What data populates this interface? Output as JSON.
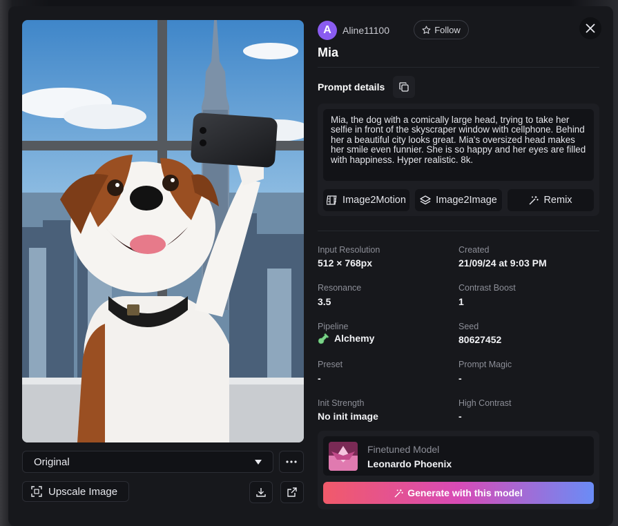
{
  "user": {
    "avatar_letter": "A",
    "name": "Aline11100",
    "follow_label": "Follow"
  },
  "title": "Mia",
  "prompt": {
    "label": "Prompt details",
    "text": "Mia, the dog with a comically large head, trying to take her selfie in front of the skyscraper window with cellphone. Behind her a beautiful city looks great. Mia's oversized head makes her smile even funnier. She is so happy and her eyes are filled with happiness. Hyper realistic. 8k.",
    "buttons": [
      "Image2Motion",
      "Image2Image",
      "Remix"
    ]
  },
  "details": {
    "input_resolution": {
      "label": "Input Resolution",
      "value": "512 × 768px"
    },
    "created": {
      "label": "Created",
      "value": "21/09/24 at 9:03 PM"
    },
    "resonance": {
      "label": "Resonance",
      "value": "3.5"
    },
    "contrast_boost": {
      "label": "Contrast Boost",
      "value": "1"
    },
    "pipeline": {
      "label": "Pipeline",
      "value": "Alchemy"
    },
    "seed": {
      "label": "Seed",
      "value": "80627452"
    },
    "preset": {
      "label": "Preset",
      "value": "-"
    },
    "prompt_magic": {
      "label": "Prompt Magic",
      "value": "-"
    },
    "init_strength": {
      "label": "Init Strength",
      "value": "No init image"
    },
    "high_contrast": {
      "label": "High Contrast",
      "value": "-"
    }
  },
  "model": {
    "label": "Finetuned Model",
    "name": "Leonardo Phoenix",
    "generate_label": "Generate with this model"
  },
  "image_controls": {
    "variant": "Original",
    "upscale_label": "Upscale Image"
  },
  "colors": {
    "accent": "#8a5cf0",
    "gradient_start": "#f15a6a",
    "gradient_end": "#6a8cf6"
  }
}
